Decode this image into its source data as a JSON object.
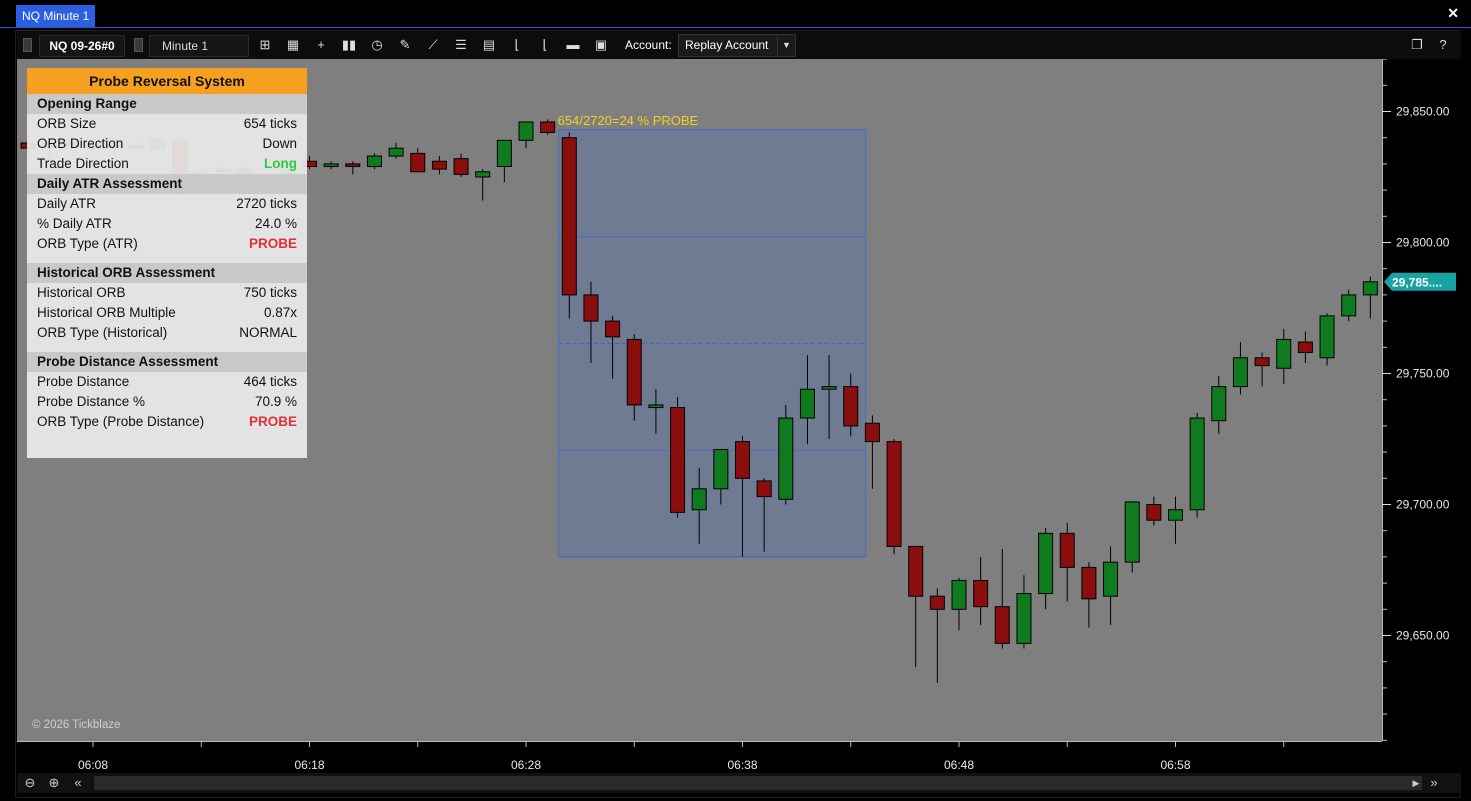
{
  "window": {
    "tab_title": "NQ Minute 1",
    "close_glyph": "✕"
  },
  "toolbar": {
    "instrument": "NQ 09-26#0",
    "period": "Minute 1",
    "account_label": "Account:",
    "account_value": "Replay Account",
    "icons": [
      "bar-type-icon",
      "indicators-icon",
      "crosshair-icon",
      "chart-style-icon",
      "clock-icon",
      "draw-pencil-icon",
      "line-tool-icon",
      "list-icon",
      "properties-icon",
      "axis-tool-icon",
      "axis-tool-2-icon",
      "open-folder-icon",
      "save-icon"
    ],
    "right_icons": [
      "copy-icon",
      "help-icon"
    ],
    "help_label": "?"
  },
  "panel": {
    "title": "Probe Reversal System",
    "sections": [
      {
        "header": "Opening Range",
        "rows": [
          {
            "label": "ORB Size",
            "value": "654 ticks",
            "style": "normal"
          },
          {
            "label": "ORB Direction",
            "value": "Down",
            "style": "normal"
          },
          {
            "label": "Trade Direction",
            "value": "Long",
            "style": "green"
          }
        ]
      },
      {
        "header": "Daily ATR Assessment",
        "rows": [
          {
            "label": "Daily ATR",
            "value": "2720 ticks",
            "style": "normal"
          },
          {
            "label": "% Daily ATR",
            "value": "24.0 %",
            "style": "normal"
          },
          {
            "label": "ORB Type (ATR)",
            "value": "PROBE",
            "style": "red"
          }
        ]
      },
      {
        "header": "Historical ORB Assessment",
        "rows": [
          {
            "label": "Historical ORB",
            "value": "750 ticks",
            "style": "normal"
          },
          {
            "label": "Historical ORB Multiple",
            "value": "0.87x",
            "style": "normal"
          },
          {
            "label": "ORB Type (Historical)",
            "value": "NORMAL",
            "style": "normal"
          }
        ]
      },
      {
        "header": "Probe Distance Assessment",
        "rows": [
          {
            "label": "Probe Distance",
            "value": "464 ticks",
            "style": "normal"
          },
          {
            "label": "Probe Distance %",
            "value": "70.9 %",
            "style": "normal"
          },
          {
            "label": "ORB Type (Probe Distance)",
            "value": "PROBE",
            "style": "red"
          }
        ]
      }
    ]
  },
  "chart_data": {
    "type": "candlestick",
    "probe_label": "654/2720=24 % PROBE",
    "orb_range": {
      "start": "06:29",
      "end": "06:43",
      "high": 29843,
      "low": 29680
    },
    "y_ticks": [
      "29,850.00",
      "29,800.00",
      "29,750.00",
      "29,700.00",
      "29,650.00"
    ],
    "y_tick_values": [
      29850,
      29800,
      29750,
      29700,
      29650
    ],
    "x_ticks": [
      "06:08",
      "06:18",
      "06:28",
      "06:38",
      "06:48",
      "06:58"
    ],
    "last_price_label": "29,785....",
    "last_price": 29785,
    "colors": {
      "up": "#0f7a1e",
      "down": "#8b0e0e",
      "background": "#7f7f7f",
      "probe_box": "#6a7a9a",
      "probe_text": "#f0d020",
      "last_price": "#17a3a3"
    },
    "candles": [
      {
        "t": "06:04",
        "o": 29834,
        "h": 29842,
        "l": 29830,
        "c": 29839
      },
      {
        "t": "06:05",
        "o": 29838,
        "h": 29841,
        "l": 29833,
        "c": 29836
      },
      {
        "t": "06:06",
        "o": 29836,
        "h": 29840,
        "l": 29830,
        "c": 29838
      },
      {
        "t": "06:07",
        "o": 29838,
        "h": 29840,
        "l": 29834,
        "c": 29837
      },
      {
        "t": "06:08",
        "o": 29837,
        "h": 29839,
        "l": 29834,
        "c": 29836
      },
      {
        "t": "06:09",
        "o": 29836,
        "h": 29839,
        "l": 29834,
        "c": 29837
      },
      {
        "t": "06:10",
        "o": 29837,
        "h": 29839,
        "l": 29835,
        "c": 29836
      },
      {
        "t": "06:11",
        "o": 29836,
        "h": 29840,
        "l": 29835,
        "c": 29839
      },
      {
        "t": "06:12",
        "o": 29839,
        "h": 29841,
        "l": 29818,
        "c": 29825
      },
      {
        "t": "06:13",
        "o": 29825,
        "h": 29828,
        "l": 29820,
        "c": 29827
      },
      {
        "t": "06:14",
        "o": 29827,
        "h": 29830,
        "l": 29825,
        "c": 29828
      },
      {
        "t": "06:15",
        "o": 29828,
        "h": 29830,
        "l": 29818,
        "c": 29819
      },
      {
        "t": "06:16",
        "o": 29819,
        "h": 29825,
        "l": 29818,
        "c": 29824
      },
      {
        "t": "06:17",
        "o": 29824,
        "h": 29832,
        "l": 29822,
        "c": 29831
      },
      {
        "t": "06:18",
        "o": 29831,
        "h": 29833,
        "l": 29828,
        "c": 29829
      },
      {
        "t": "06:19",
        "o": 29829,
        "h": 29831,
        "l": 29828,
        "c": 29830
      },
      {
        "t": "06:20",
        "o": 29830,
        "h": 29831,
        "l": 29826,
        "c": 29829
      },
      {
        "t": "06:21",
        "o": 29829,
        "h": 29834,
        "l": 29828,
        "c": 29833
      },
      {
        "t": "06:22",
        "o": 29833,
        "h": 29838,
        "l": 29832,
        "c": 29836
      },
      {
        "t": "06:23",
        "o": 29834,
        "h": 29836,
        "l": 29827,
        "c": 29827
      },
      {
        "t": "06:24",
        "o": 29831,
        "h": 29833,
        "l": 29826,
        "c": 29828
      },
      {
        "t": "06:25",
        "o": 29832,
        "h": 29834,
        "l": 29825,
        "c": 29826
      },
      {
        "t": "06:26",
        "o": 29825,
        "h": 29828,
        "l": 29816,
        "c": 29827
      },
      {
        "t": "06:27",
        "o": 29829,
        "h": 29839,
        "l": 29823,
        "c": 29839
      },
      {
        "t": "06:28",
        "o": 29839,
        "h": 29846,
        "l": 29836,
        "c": 29846
      },
      {
        "t": "06:29",
        "o": 29846,
        "h": 29847,
        "l": 29841,
        "c": 29842
      },
      {
        "t": "06:30",
        "o": 29840,
        "h": 29842,
        "l": 29771,
        "c": 29780
      },
      {
        "t": "06:31",
        "o": 29780,
        "h": 29785,
        "l": 29754,
        "c": 29770
      },
      {
        "t": "06:32",
        "o": 29770,
        "h": 29772,
        "l": 29748,
        "c": 29764
      },
      {
        "t": "06:33",
        "o": 29763,
        "h": 29765,
        "l": 29732,
        "c": 29738
      },
      {
        "t": "06:34",
        "o": 29737,
        "h": 29744,
        "l": 29727,
        "c": 29738
      },
      {
        "t": "06:35",
        "o": 29737,
        "h": 29741,
        "l": 29695,
        "c": 29697
      },
      {
        "t": "06:36",
        "o": 29698,
        "h": 29714,
        "l": 29685,
        "c": 29706
      },
      {
        "t": "06:37",
        "o": 29706,
        "h": 29719,
        "l": 29700,
        "c": 29721
      },
      {
        "t": "06:38",
        "o": 29724,
        "h": 29726,
        "l": 29680,
        "c": 29710
      },
      {
        "t": "06:39",
        "o": 29709,
        "h": 29710,
        "l": 29682,
        "c": 29703
      },
      {
        "t": "06:40",
        "o": 29702,
        "h": 29738,
        "l": 29700,
        "c": 29733
      },
      {
        "t": "06:41",
        "o": 29733,
        "h": 29757,
        "l": 29723,
        "c": 29744
      },
      {
        "t": "06:42",
        "o": 29744,
        "h": 29757,
        "l": 29725,
        "c": 29745
      },
      {
        "t": "06:43",
        "o": 29745,
        "h": 29750,
        "l": 29726,
        "c": 29730
      },
      {
        "t": "06:44",
        "o": 29731,
        "h": 29734,
        "l": 29706,
        "c": 29724
      },
      {
        "t": "06:45",
        "o": 29724,
        "h": 29725,
        "l": 29681,
        "c": 29684
      },
      {
        "t": "06:46",
        "o": 29684,
        "h": 29684,
        "l": 29638,
        "c": 29665
      },
      {
        "t": "06:47",
        "o": 29665,
        "h": 29668,
        "l": 29632,
        "c": 29660
      },
      {
        "t": "06:48",
        "o": 29660,
        "h": 29672,
        "l": 29652,
        "c": 29671
      },
      {
        "t": "06:49",
        "o": 29671,
        "h": 29680,
        "l": 29654,
        "c": 29661
      },
      {
        "t": "06:50",
        "o": 29661,
        "h": 29683,
        "l": 29645,
        "c": 29647
      },
      {
        "t": "06:51",
        "o": 29647,
        "h": 29673,
        "l": 29645,
        "c": 29666
      },
      {
        "t": "06:52",
        "o": 29666,
        "h": 29691,
        "l": 29660,
        "c": 29689
      },
      {
        "t": "06:53",
        "o": 29689,
        "h": 29693,
        "l": 29663,
        "c": 29676
      },
      {
        "t": "06:54",
        "o": 29676,
        "h": 29678,
        "l": 29653,
        "c": 29664
      },
      {
        "t": "06:55",
        "o": 29665,
        "h": 29684,
        "l": 29654,
        "c": 29678
      },
      {
        "t": "06:56",
        "o": 29678,
        "h": 29701,
        "l": 29674,
        "c": 29701
      },
      {
        "t": "06:57",
        "o": 29700,
        "h": 29703,
        "l": 29692,
        "c": 29694
      },
      {
        "t": "06:58",
        "o": 29694,
        "h": 29703,
        "l": 29685,
        "c": 29698
      },
      {
        "t": "06:59",
        "o": 29698,
        "h": 29735,
        "l": 29695,
        "c": 29733
      },
      {
        "t": "07:00",
        "o": 29732,
        "h": 29749,
        "l": 29727,
        "c": 29745
      },
      {
        "t": "07:01",
        "o": 29745,
        "h": 29762,
        "l": 29742,
        "c": 29756
      },
      {
        "t": "07:02",
        "o": 29756,
        "h": 29758,
        "l": 29745,
        "c": 29753
      },
      {
        "t": "07:03",
        "o": 29752,
        "h": 29767,
        "l": 29746,
        "c": 29763
      },
      {
        "t": "07:04",
        "o": 29762,
        "h": 29766,
        "l": 29754,
        "c": 29758
      },
      {
        "t": "07:05",
        "o": 29756,
        "h": 29773,
        "l": 29753,
        "c": 29772
      },
      {
        "t": "07:06",
        "o": 29772,
        "h": 29782,
        "l": 29770,
        "c": 29780
      },
      {
        "t": "07:07",
        "o": 29780,
        "h": 29787,
        "l": 29771,
        "c": 29785
      }
    ]
  },
  "status": {
    "copyright": "© 2026 Tickblaze"
  },
  "scrollbar": {
    "icons": [
      "zoom-out-icon",
      "zoom-in-icon",
      "scroll-fast-left-icon",
      "scroll-left-icon",
      "scroll-right-icon",
      "scroll-fast-right-icon"
    ]
  }
}
